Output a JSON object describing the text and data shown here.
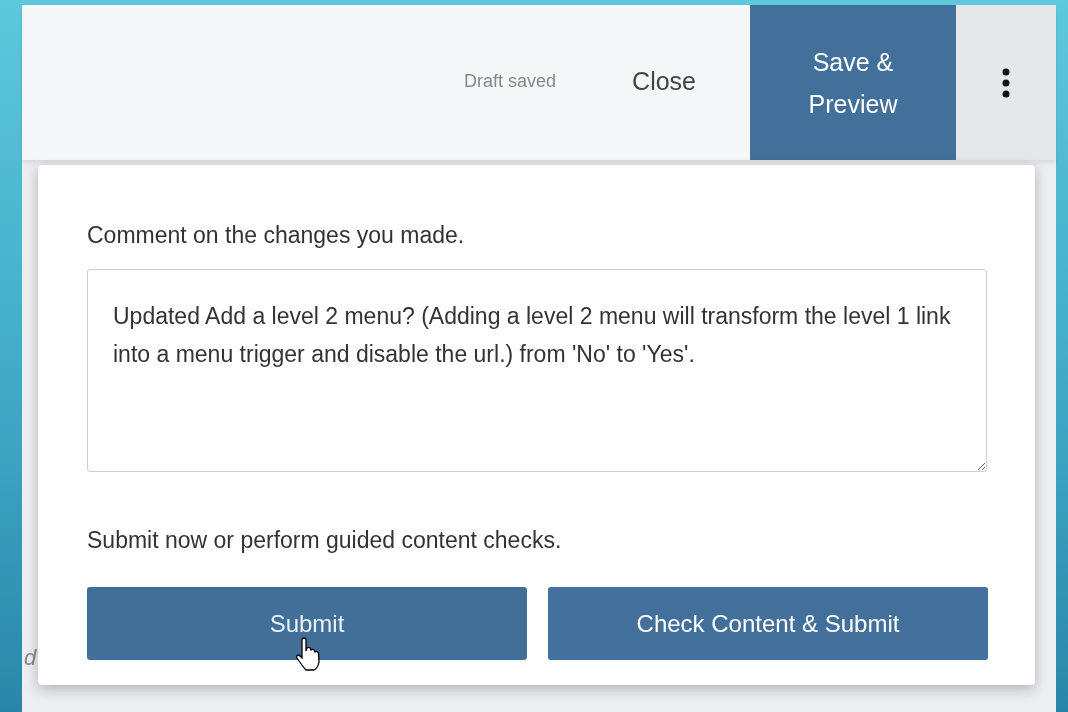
{
  "header": {
    "status": "Draft saved",
    "close": "Close",
    "save_button": "Save & Preview"
  },
  "page": {
    "partial_text": "d"
  },
  "popup": {
    "comment_label": "Comment on the changes you made.",
    "comment_value": "Updated Add a level 2 menu? (Adding a level 2 menu will transform the level 1 link into a menu trigger and disable the url.) from 'No' to 'Yes'.",
    "submit_label": "Submit now or perform guided content checks.",
    "buttons": [
      {
        "label": "Submit",
        "hovered": true
      },
      {
        "label": "Check Content & Submit",
        "hovered": false
      }
    ]
  }
}
